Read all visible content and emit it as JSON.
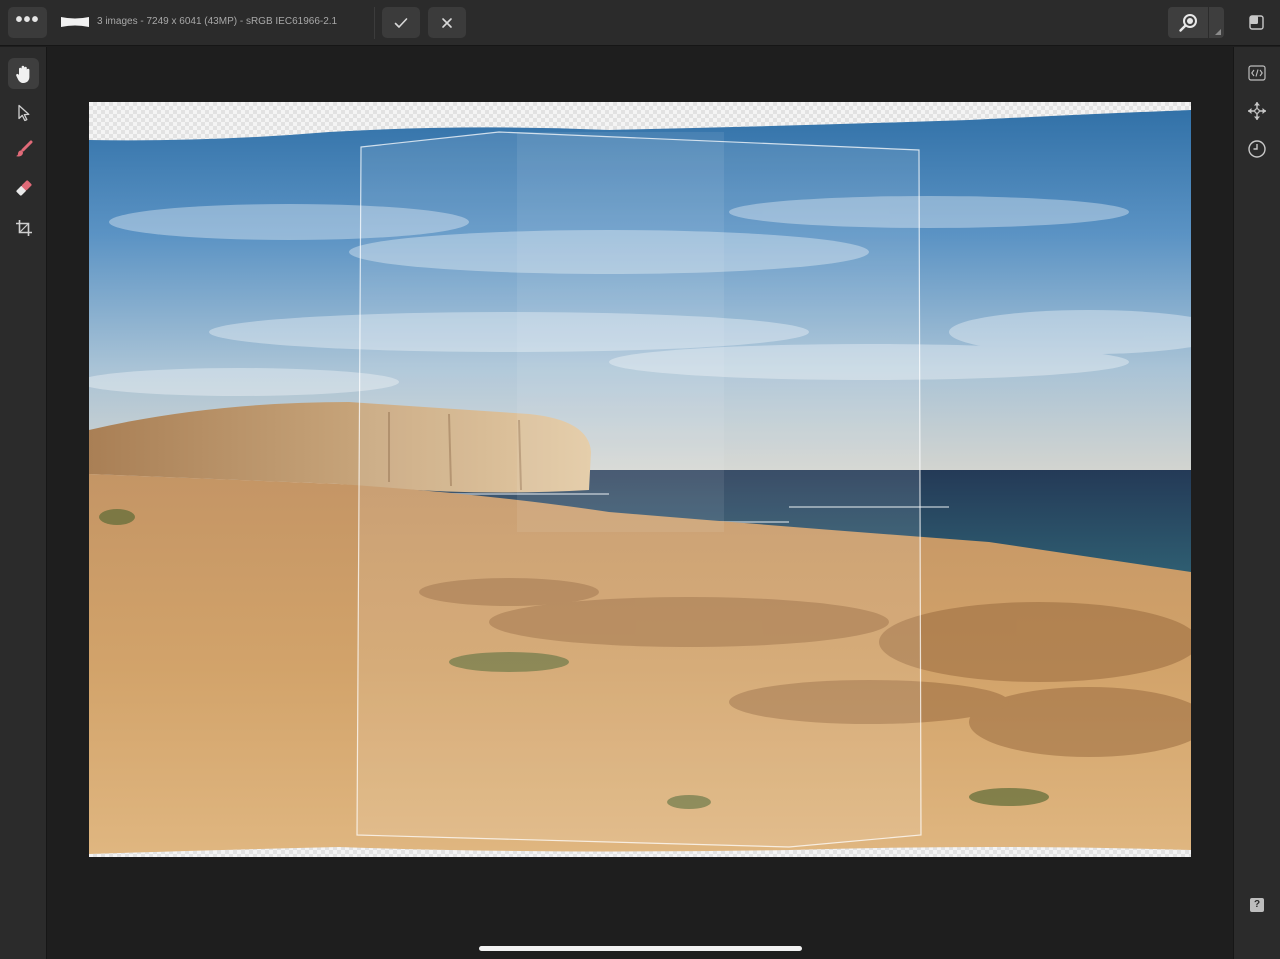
{
  "top_bar": {
    "menu_icon": "more-dots-icon",
    "document_info": "3 images - 7249 x 6041 (43MP) - sRGB IEC61966-2.1",
    "commit_icon": "checkmark-icon",
    "cancel_icon": "close-icon",
    "zoom_icon": "magnifier-icon",
    "layers_icon": "layers-panel-icon"
  },
  "left_tools": [
    {
      "name": "hand-tool",
      "icon": "hand-icon",
      "active": true
    },
    {
      "name": "move-tool",
      "icon": "arrow-pointer-icon",
      "active": false
    },
    {
      "name": "source-add-brush",
      "icon": "brush-icon",
      "active": false
    },
    {
      "name": "source-remove-brush",
      "icon": "eraser-icon",
      "active": false
    },
    {
      "name": "crop-tool",
      "icon": "crop-icon",
      "active": false
    }
  ],
  "right_tools": [
    {
      "name": "code-panel",
      "icon": "code-icon"
    },
    {
      "name": "transform-panel",
      "icon": "move-arrows-icon"
    },
    {
      "name": "history-panel",
      "icon": "clock-icon"
    }
  ],
  "help": {
    "label": "?"
  },
  "canvas": {
    "content": "stitched panorama of three images",
    "source_count": 3
  },
  "colors": {
    "chrome": "#2b2b2b",
    "workspace": "#1e1e1e",
    "button": "#3b3b3b",
    "icon": "#c8c8c8"
  }
}
